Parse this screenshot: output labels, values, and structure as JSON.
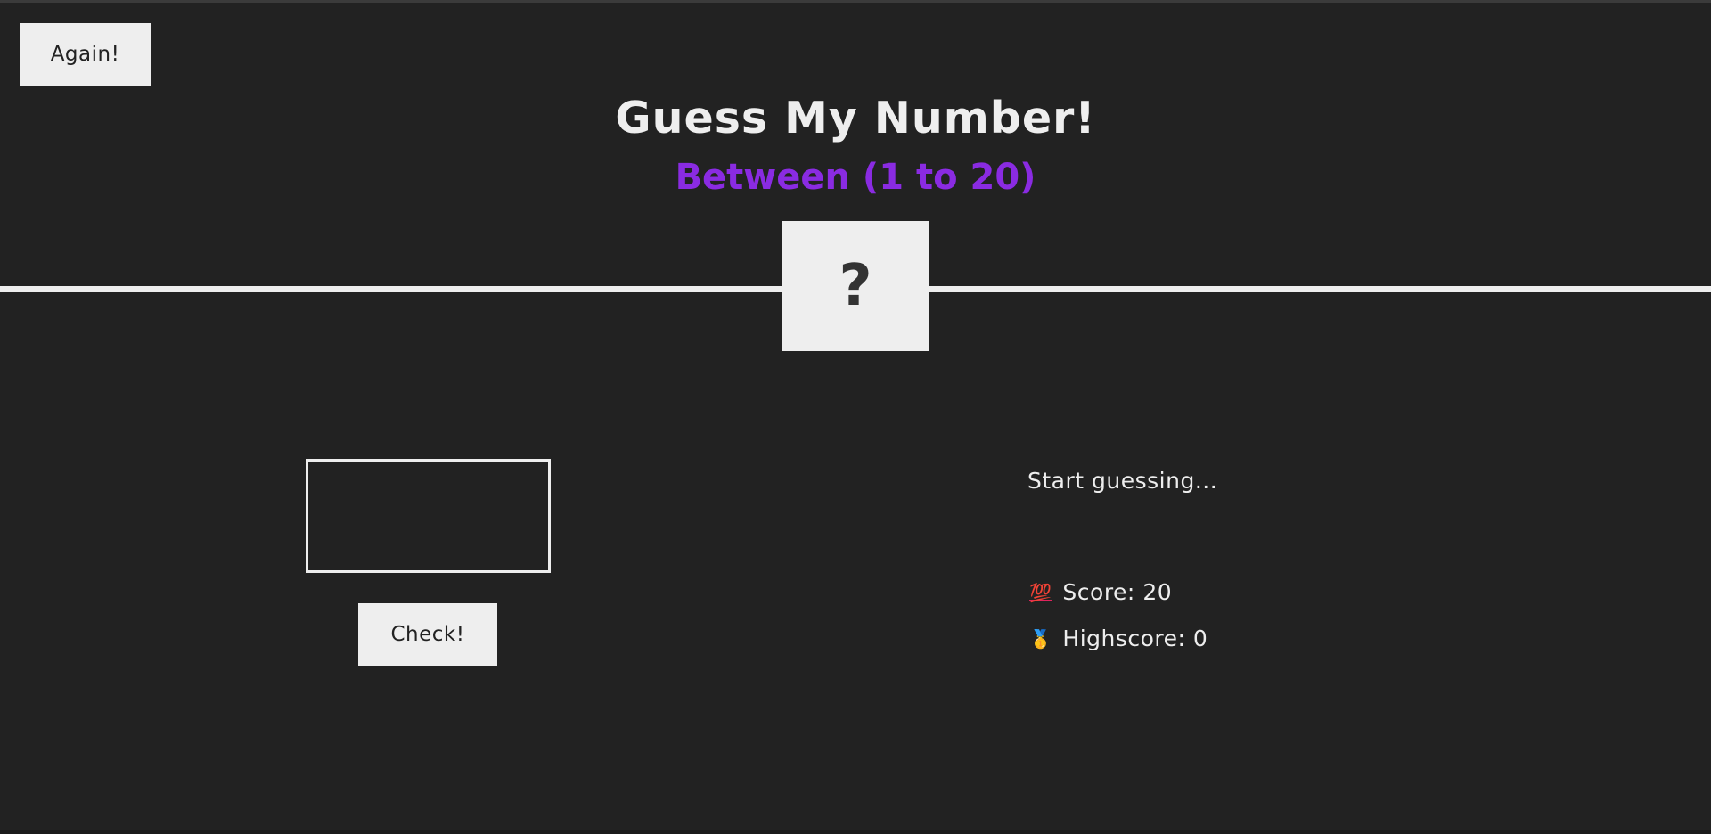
{
  "header": {
    "again_label": "Again!",
    "title": "Guess My Number!",
    "subtitle": "Between (1 to 20)",
    "secret_number": "?"
  },
  "left": {
    "guess_value": "",
    "check_label": "Check!"
  },
  "right": {
    "message": "Start guessing...",
    "score_icon": "100-icon",
    "score_label": "Score:",
    "score_value": "20",
    "highscore_icon": "medal-icon",
    "highscore_label": "Highscore:",
    "highscore_value": "0"
  },
  "colors": {
    "background": "#222222",
    "foreground": "#eeeeee",
    "accent": "#8a2be2"
  }
}
